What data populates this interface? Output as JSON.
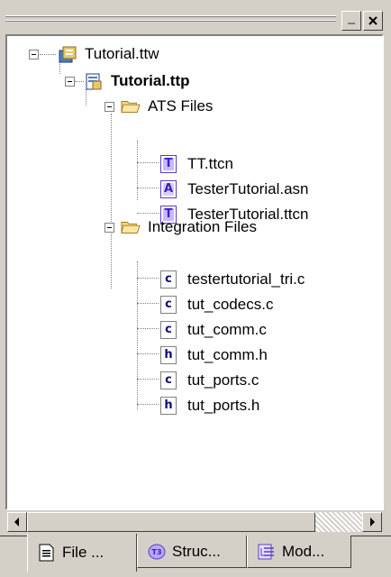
{
  "window": {
    "minimize_icon": "minimize-icon",
    "close_icon": "close-icon"
  },
  "tree": {
    "workspace": {
      "label": "Tutorial.ttw",
      "icon": "workspace-icon"
    },
    "project": {
      "label": "Tutorial.ttp",
      "icon": "project-icon"
    },
    "ats_folder": {
      "label": "ATS Files",
      "icon": "folder-open-icon"
    },
    "ats_files": [
      {
        "label": "TT.ttcn",
        "icon_letter": "T",
        "icon": "ttcn-file-icon"
      },
      {
        "label": "TesterTutorial.asn",
        "icon_letter": "A",
        "icon": "asn-file-icon"
      },
      {
        "label": "TesterTutorial.ttcn",
        "icon_letter": "T",
        "icon": "ttcn-file-icon"
      }
    ],
    "integration_folder": {
      "label": "Integration Files",
      "icon": "folder-open-icon"
    },
    "integration_files": [
      {
        "label": "testertutorial_tri.c",
        "icon_letter": "c",
        "icon": "c-file-icon"
      },
      {
        "label": "tut_codecs.c",
        "icon_letter": "c",
        "icon": "c-file-icon"
      },
      {
        "label": "tut_comm.c",
        "icon_letter": "c",
        "icon": "c-file-icon"
      },
      {
        "label": "tut_comm.h",
        "icon_letter": "h",
        "icon": "h-file-icon"
      },
      {
        "label": "tut_ports.c",
        "icon_letter": "c",
        "icon": "c-file-icon"
      },
      {
        "label": "tut_ports.h",
        "icon_letter": "h",
        "icon": "h-file-icon"
      }
    ]
  },
  "tabs": [
    {
      "label": "File ...",
      "icon": "file-view-icon",
      "active": true
    },
    {
      "label": "Struc...",
      "icon": "structure-view-icon",
      "active": false
    },
    {
      "label": "Mod...",
      "icon": "module-view-icon",
      "active": false
    }
  ],
  "colors": {
    "ttcn_letter": "#3b1fbf",
    "asn_letter": "#3b1fbf",
    "c_letter": "#0b0b7a",
    "folder": "#f5d77a"
  }
}
